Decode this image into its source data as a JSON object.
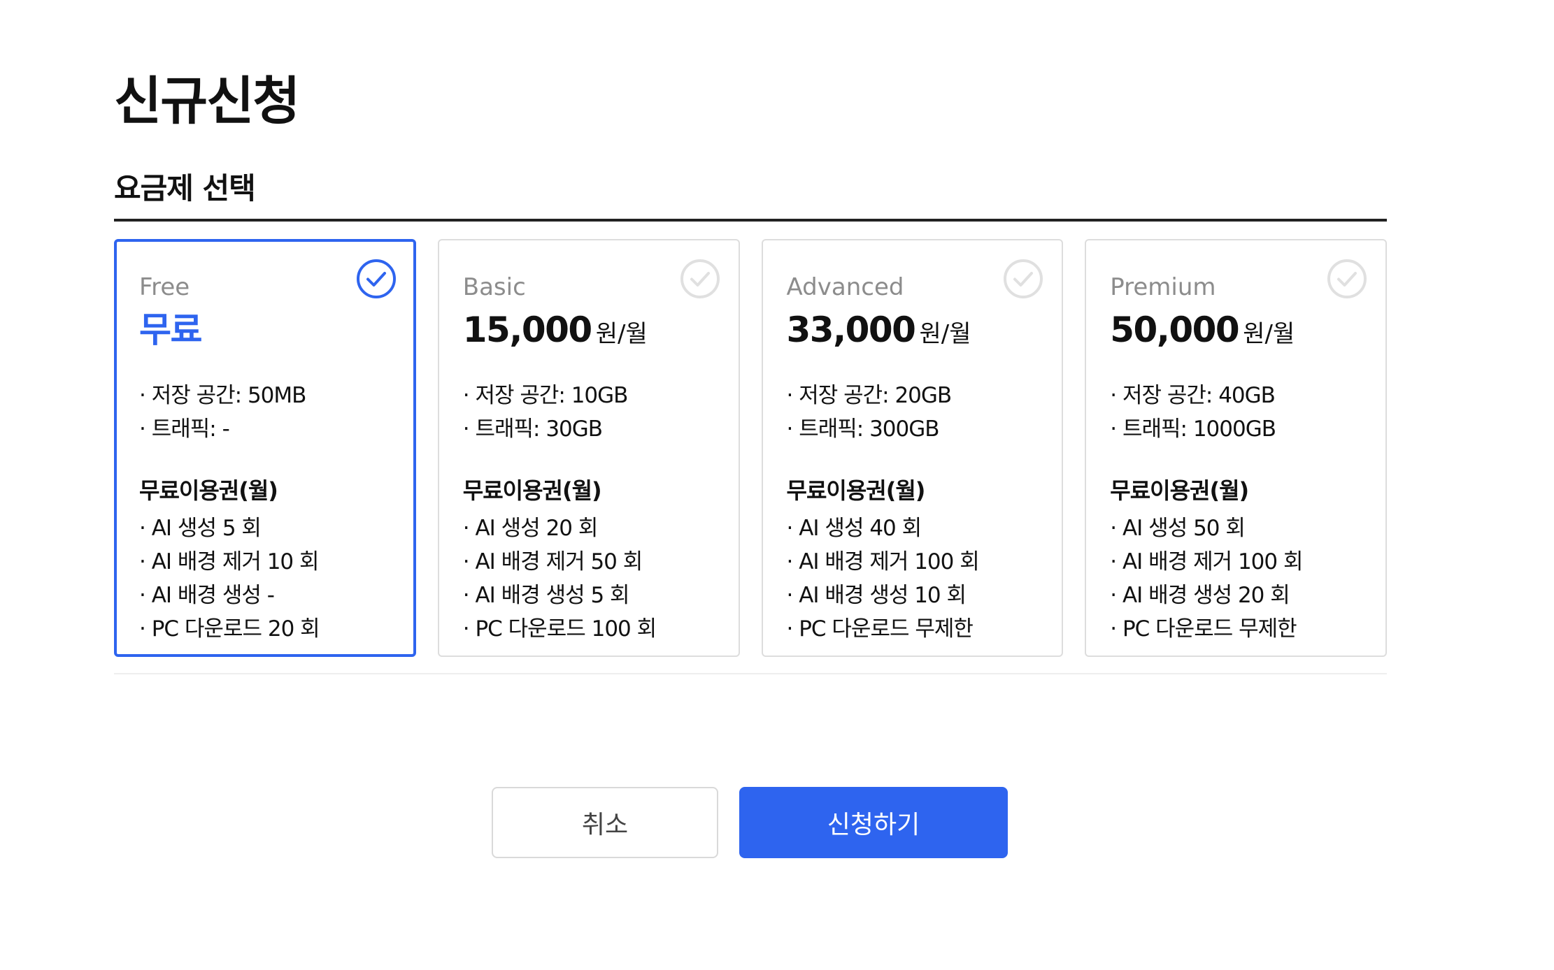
{
  "page": {
    "title": "신규신청",
    "section_title": "요금제 선택"
  },
  "colors": {
    "accent": "#2e64ef",
    "text": "#111111",
    "muted": "#8c8c8c",
    "border": "#dddddd"
  },
  "plans": [
    {
      "name": "Free",
      "price": "무료",
      "unit": "",
      "selected": true,
      "specs": [
        "저장 공간: 50MB",
        "트래픽: -"
      ],
      "benefit_title": "무료이용권(월)",
      "benefits": [
        "AI 생성 5 회",
        "AI 배경 제거 10 회",
        "AI 배경 생성 -",
        "PC 다운로드 20 회"
      ]
    },
    {
      "name": "Basic",
      "price": "15,000",
      "unit": "원/월",
      "selected": false,
      "specs": [
        "저장 공간: 10GB",
        "트래픽: 30GB"
      ],
      "benefit_title": "무료이용권(월)",
      "benefits": [
        "AI 생성 20 회",
        "AI 배경 제거 50 회",
        "AI 배경 생성 5 회",
        "PC 다운로드 100 회"
      ]
    },
    {
      "name": "Advanced",
      "price": "33,000",
      "unit": "원/월",
      "selected": false,
      "specs": [
        "저장 공간: 20GB",
        "트래픽: 300GB"
      ],
      "benefit_title": "무료이용권(월)",
      "benefits": [
        "AI 생성 40 회",
        "AI 배경 제거 100 회",
        "AI 배경 생성 10 회",
        "PC 다운로드 무제한"
      ]
    },
    {
      "name": "Premium",
      "price": "50,000",
      "unit": "원/월",
      "selected": false,
      "specs": [
        "저장 공간: 40GB",
        "트래픽: 1000GB"
      ],
      "benefit_title": "무료이용권(월)",
      "benefits": [
        "AI 생성 50 회",
        "AI 배경 제거 100 회",
        "AI 배경 생성 20 회",
        "PC 다운로드 무제한"
      ]
    }
  ],
  "actions": {
    "cancel_label": "취소",
    "submit_label": "신청하기"
  }
}
